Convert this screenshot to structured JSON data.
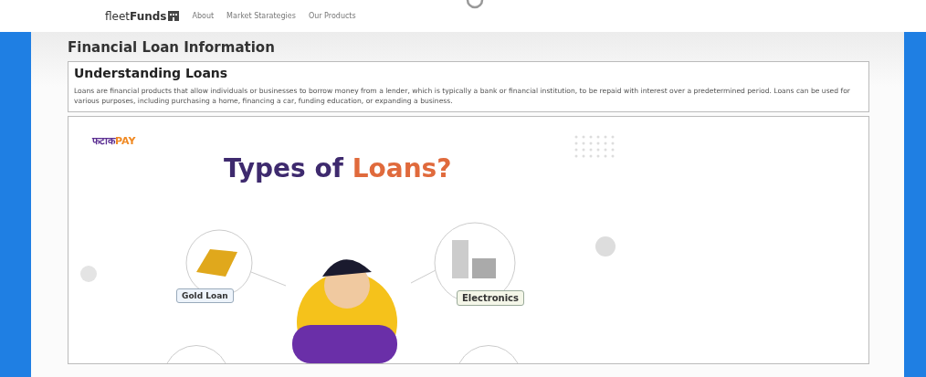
{
  "nav": {
    "brand": "fleet**Funds**",
    "links": [
      "About",
      "Market Starategies",
      "Our Products"
    ]
  },
  "page": {
    "title": "Financial Loan Information"
  },
  "intro": {
    "heading": "Understanding Loans",
    "body": "Loans are financial products that allow individuals or businesses to borrow money from a lender, which is typically a bank or financial institution, to be repaid with interest over a predetermined period. Loans can be used for various purposes, including purchasing a home, financing a car, funding education, or expanding a business."
  },
  "infographic": {
    "logo_left": "फटाक",
    "logo_right": "PAY",
    "title_left": "Types of",
    "title_right": "Loans?",
    "labels": [
      {
        "text": "Gold Loan",
        "kind": "gold"
      },
      {
        "text": "Electronics",
        "kind": "electronics"
      }
    ]
  }
}
